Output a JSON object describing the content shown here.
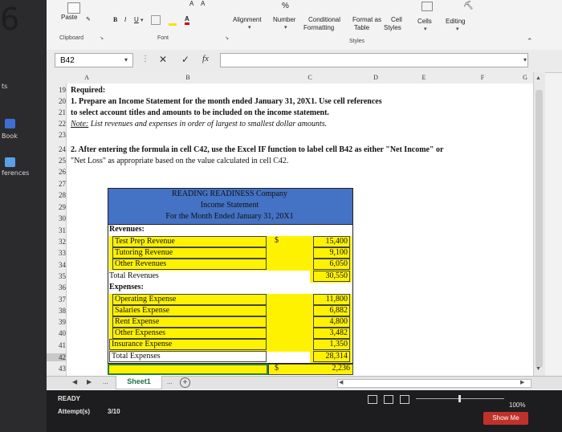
{
  "left_panel": {
    "big_number": "6",
    "items": [
      "ts",
      "Book",
      "ferences"
    ]
  },
  "ribbon": {
    "paste": "Paste",
    "clipboard_group": "Clipboard",
    "font_group": "Font",
    "alignment": "Alignment",
    "number": "Number",
    "conditional_formatting": "Conditional",
    "conditional_formatting2": "Formatting",
    "format_as_table": "Format as",
    "format_as_table2": "Table",
    "cell_styles": "Cell",
    "cell_styles2": "Styles",
    "styles_group": "Styles",
    "cells": "Cells",
    "editing": "Editing",
    "percent": "%",
    "font_a1": "A",
    "font_a2": "A",
    "bold": "B",
    "italic": "I",
    "underline": "U"
  },
  "formula_bar": {
    "name_box": "B42",
    "fx": "fx",
    "cancel": "✕",
    "enter": "✓"
  },
  "columns": [
    "A",
    "B",
    "C",
    "D",
    "E",
    "F",
    "G"
  ],
  "rows": [
    "19",
    "20",
    "21",
    "22",
    "23",
    "24",
    "25",
    "26",
    "27",
    "28",
    "29",
    "30",
    "31",
    "32",
    "33",
    "34",
    "35",
    "36",
    "37",
    "38",
    "39",
    "40",
    "41",
    "42",
    "43"
  ],
  "instructions": {
    "required": "Required:",
    "line1": "1. Prepare an Income Statement for the month ended January 31, 20X1. Use cell references",
    "line2": "to select account titles and amounts to be included on the income statement.",
    "note_label": "Note:",
    "note_text": "List revenues and expenses in order of largest to smallest dollar amounts.",
    "line3": "2. After entering the formula in cell C42, use the Excel IF function to label cell B42 as either \"Net Income\" or",
    "line4": "\"Net Loss\" as appropriate based on the value calculated in cell C42."
  },
  "statement": {
    "company": "READING READINESS Company",
    "title": "Income Statement",
    "period": "For the Month Ended January 31, 20X1",
    "revenues_label": "Revenues:",
    "revenues": [
      {
        "name": "Test Prep Revenue",
        "dollar": "$",
        "amount": "15,400"
      },
      {
        "name": "Tutoring Revenue",
        "dollar": "",
        "amount": "9,100"
      },
      {
        "name": "Other Revenues",
        "dollar": "",
        "amount": "6,050"
      }
    ],
    "total_revenues_label": "Total Revenues",
    "total_revenues": "30,550",
    "expenses_label": "Expenses:",
    "expenses": [
      {
        "name": "Operating Expense",
        "amount": "11,800"
      },
      {
        "name": "Salaries Expense",
        "amount": "6,882"
      },
      {
        "name": "Rent Expense",
        "amount": "4,800"
      },
      {
        "name": "Other Expenses",
        "amount": "3,482"
      },
      {
        "name": "Insurance Expense",
        "amount": "1,350"
      }
    ],
    "total_expenses_label": "Total Expenses",
    "total_expenses": "28,314",
    "net_dollar": "$",
    "net_amount": "2,236"
  },
  "sheet_tabs": {
    "ellipsis_left": "...",
    "active": "Sheet1",
    "ellipsis_right": "...",
    "add": "+"
  },
  "status_bar": {
    "ready": "READY",
    "attempts_label": "Attempt(s)",
    "attempts_value": "3/10",
    "zoom": "100%",
    "show_me": "Show Me"
  },
  "colors": {
    "header_blue": "#4472c4",
    "highlight_yellow": "#fff200",
    "show_me_red": "#c0312b"
  }
}
